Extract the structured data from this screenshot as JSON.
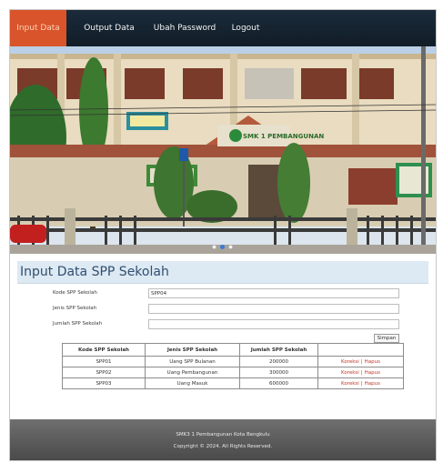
{
  "nav": {
    "items": [
      {
        "label": "Input Data",
        "active": true
      },
      {
        "label": "Output Data",
        "active": false
      },
      {
        "label": "Ubah Password",
        "active": false
      },
      {
        "label": "Logout",
        "active": false
      }
    ]
  },
  "banner": {
    "school_sign": "SMK 1 PEMBANGUNAN",
    "slider_dots": 3
  },
  "form": {
    "title": "Input Data SPP Sekolah",
    "kode_label": "Kode SPP Sekolah",
    "kode_value": "SPP04",
    "jenis_label": "Jenis SPP Sekolah",
    "jenis_value": "",
    "jumlah_label": "Jumlah SPP Sekolah",
    "jumlah_value": "",
    "submit_label": "Simpan"
  },
  "table": {
    "headers": [
      "Kode SPP Sekolah",
      "Jenis SPP Sekolah",
      "Jumlah SPP Sekolah",
      ""
    ],
    "rows": [
      {
        "kode": "SPP01",
        "jenis": "Uang SPP Bulanan",
        "jumlah": "200000",
        "edit": "Koreksi",
        "delete": "Hapus"
      },
      {
        "kode": "SPP02",
        "jenis": "Uang Pembangunan",
        "jumlah": "300000",
        "edit": "Koreksi",
        "delete": "Hapus"
      },
      {
        "kode": "SPP03",
        "jenis": "Uang Masuk",
        "jumlah": "600000",
        "edit": "Koreksi",
        "delete": "Hapus"
      }
    ]
  },
  "footer": {
    "line1": "SMK3 1 Pembangunan Kota Bengkulu",
    "line2": "Copyright © 2024. All Rights Reserved."
  },
  "colors": {
    "nav_bg": "#152331",
    "nav_active": "#d9542a",
    "panel_bg": "#dde9f3",
    "link": "#c0392b",
    "footer_bg": "#5c5c5c"
  }
}
